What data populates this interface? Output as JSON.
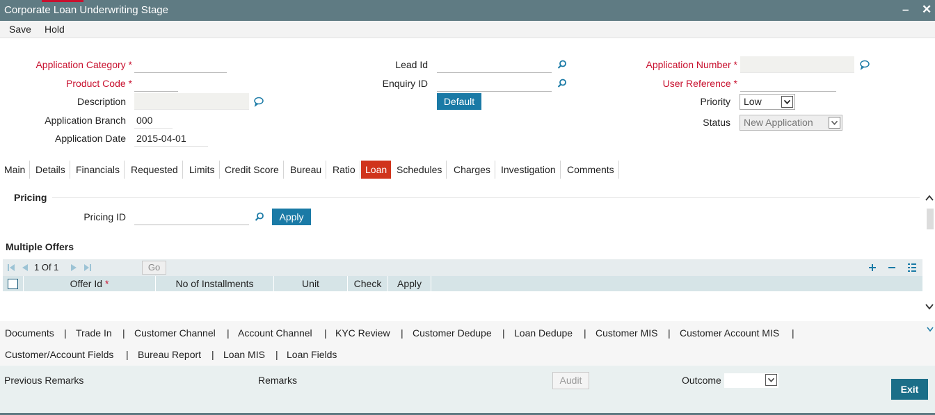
{
  "window": {
    "title": "Corporate Loan Underwriting Stage"
  },
  "menu": {
    "save": "Save",
    "hold": "Hold"
  },
  "form": {
    "application_category": {
      "label": "Application Category",
      "value": ""
    },
    "product_code": {
      "label": "Product Code",
      "value": ""
    },
    "description": {
      "label": "Description",
      "value": ""
    },
    "application_branch": {
      "label": "Application Branch",
      "value": "000"
    },
    "application_date": {
      "label": "Application Date",
      "value": "2015-04-01"
    },
    "lead_id": {
      "label": "Lead Id",
      "value": ""
    },
    "enquiry_id": {
      "label": "Enquiry ID",
      "value": ""
    },
    "default_button": "Default",
    "application_number": {
      "label": "Application Number",
      "value": ""
    },
    "user_reference": {
      "label": "User Reference",
      "value": ""
    },
    "priority": {
      "label": "Priority",
      "value": "Low"
    },
    "status": {
      "label": "Status",
      "value": "New Application"
    },
    "required_mark": "*"
  },
  "tabs": [
    "Main",
    "Details",
    "Financials",
    "Requested",
    "Limits",
    "Credit Score",
    "Bureau",
    "Ratio",
    "Loan",
    "Schedules",
    "Charges",
    "Investigation",
    "Comments"
  ],
  "active_tab": "Loan",
  "pricing": {
    "title": "Pricing",
    "pricing_id_label": "Pricing ID",
    "pricing_id_value": "",
    "apply": "Apply"
  },
  "offers": {
    "title": "Multiple Offers",
    "pager": {
      "text": "1 Of 1",
      "go": "Go"
    },
    "columns": [
      "Offer Id",
      "No of Installments",
      "Unit",
      "Check",
      "Apply"
    ]
  },
  "links": {
    "row1": [
      "Documents",
      "Trade In",
      "Customer Channel",
      "Account Channel",
      "KYC Review",
      "Customer Dedupe",
      "Loan Dedupe",
      "Customer MIS",
      "Customer Account MIS"
    ],
    "row2": [
      "Customer/Account Fields",
      "Bureau Report",
      "Loan MIS",
      "Loan Fields"
    ],
    "separator": "|"
  },
  "footer": {
    "previous_remarks": "Previous Remarks",
    "remarks": "Remarks",
    "audit": "Audit",
    "outcome_label": "Outcome",
    "outcome_value": "",
    "exit": "Exit"
  },
  "colors": {
    "titlebar": "#5f7b83",
    "accent": "#1a7aa6",
    "active_tab": "#d0341c",
    "required": "#c8102e"
  },
  "icons": [
    "search-icon",
    "comment-icon",
    "first-page-icon",
    "prev-page-icon",
    "next-page-icon",
    "last-page-icon",
    "add-row-icon",
    "delete-row-icon",
    "single-view-icon",
    "chevron-up-icon",
    "chevron-down-icon",
    "minimize-icon",
    "close-icon"
  ]
}
